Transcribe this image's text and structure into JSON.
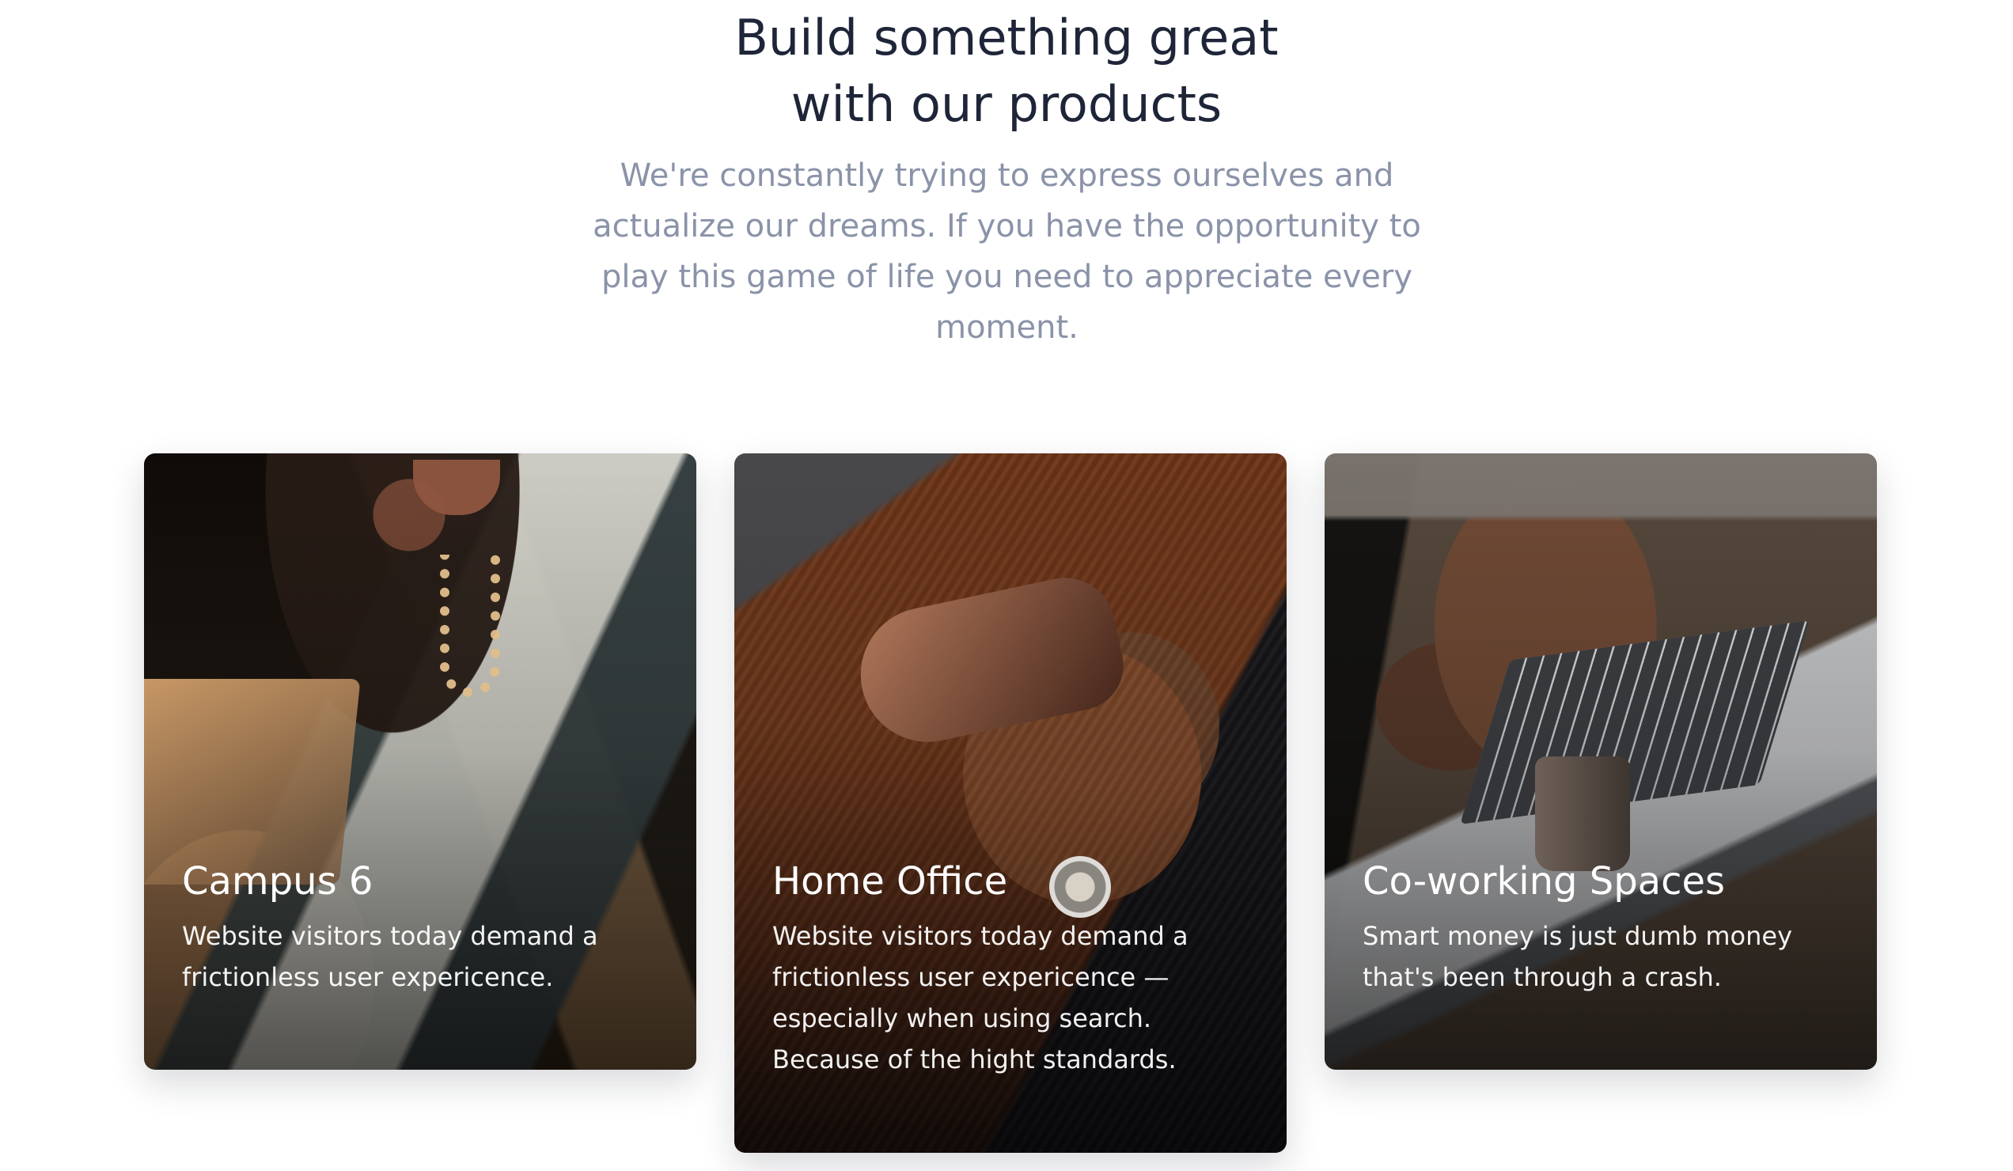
{
  "hero": {
    "title_line_1": "Build something great",
    "title_line_2": "with our products",
    "subtitle": "We're constantly trying to express ourselves and actualize our dreams. If you have the opportunity to play this game of life you need to appreciate every moment."
  },
  "cards": [
    {
      "title": "Campus 6",
      "description": "Website visitors today demand a frictionless user expericence."
    },
    {
      "title": "Home Office",
      "description": "Website visitors today demand a frictionless user expericence — especially when using search. Because of the hight standards."
    },
    {
      "title": "Co-working Spaces",
      "description": "Smart money is just dumb money that's been through a crash."
    }
  ]
}
